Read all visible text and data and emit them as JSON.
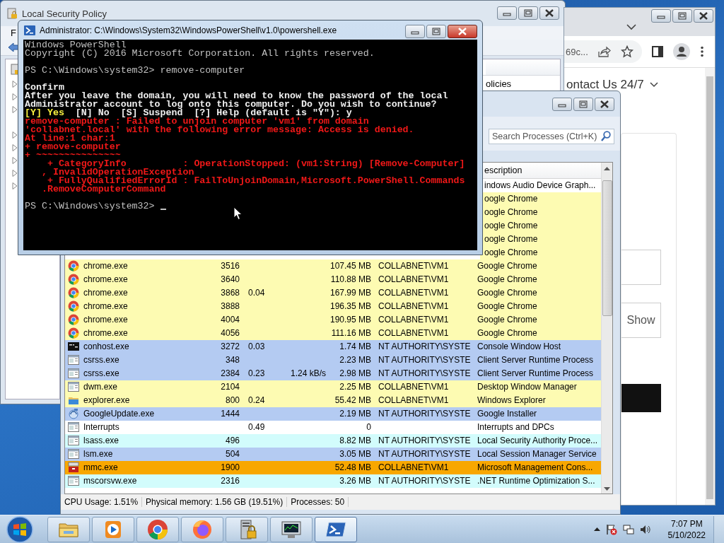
{
  "local_security_policy": {
    "title": "Local Security Policy",
    "menu": [
      "F"
    ],
    "tree_items": [
      {
        "kind": "node",
        "expanded": false
      },
      {
        "kind": "node",
        "expanded": false
      },
      {
        "kind": "node",
        "expanded": false
      },
      {
        "kind": "leaf"
      },
      {
        "kind": "node",
        "expanded": false
      },
      {
        "kind": "node",
        "expanded": false
      },
      {
        "kind": "node",
        "expanded": false
      },
      {
        "kind": "node",
        "expanded": false
      },
      {
        "kind": "node",
        "expanded": false
      }
    ],
    "list_items": [
      "olicies"
    ]
  },
  "browser": {
    "address": "69c...",
    "heading": "ontact Us 24/7",
    "show_button": "Show"
  },
  "process_explorer": {
    "search": {
      "placeholder": "Search Processes (Ctrl+K)"
    },
    "columns": [
      {
        "label": "escription"
      }
    ],
    "rows": [
      {
        "color": "#ffffff",
        "column_7": "indows Audio Device Graph..."
      },
      {
        "color": "#fdfbb2",
        "column_7": "oogle Chrome"
      },
      {
        "color": "#fdfbb2",
        "column_7": "oogle Chrome"
      },
      {
        "color": "#fdfbb2",
        "column_7": "oogle Chrome"
      },
      {
        "color": "#fdfbb2",
        "column_7": "oogle Chrome"
      },
      {
        "color": "#fdfbb2",
        "column_7": "oogle Chrome"
      },
      {
        "kind": "chrome",
        "color": "#fdfbb2",
        "column_1": "chrome.exe",
        "column_2": "3516",
        "column_5": "107.45 MB",
        "column_6": "COLLABNET\\VM1",
        "column_7": "Google Chrome"
      },
      {
        "kind": "chrome",
        "color": "#fdfbb2",
        "column_1": "chrome.exe",
        "column_2": "3640",
        "column_5": "110.88 MB",
        "column_6": "COLLABNET\\VM1",
        "column_7": "Google Chrome"
      },
      {
        "kind": "chrome",
        "color": "#fdfbb2",
        "column_1": "chrome.exe",
        "column_2": "3868",
        "column_3": "0.04",
        "column_5": "167.99 MB",
        "column_6": "COLLABNET\\VM1",
        "column_7": "Google Chrome"
      },
      {
        "kind": "chrome",
        "color": "#fdfbb2",
        "column_1": "chrome.exe",
        "column_2": "3888",
        "column_5": "196.35 MB",
        "column_6": "COLLABNET\\VM1",
        "column_7": "Google Chrome"
      },
      {
        "kind": "chrome",
        "color": "#fdfbb2",
        "column_1": "chrome.exe",
        "column_2": "4004",
        "column_5": "190.95 MB",
        "column_6": "COLLABNET\\VM1",
        "column_7": "Google Chrome"
      },
      {
        "kind": "chrome",
        "color": "#fdfbb2",
        "column_1": "chrome.exe",
        "column_2": "4056",
        "column_5": "111.16 MB",
        "column_6": "COLLABNET\\VM1",
        "column_7": "Google Chrome"
      },
      {
        "kind": "console",
        "color": "#b4cbf2",
        "column_1": "conhost.exe",
        "column_2": "3272",
        "column_3": "0.03",
        "column_5": "1.74 MB",
        "column_6": "NT AUTHORITY\\SYSTE",
        "column_7": "Console Window Host"
      },
      {
        "kind": "window",
        "color": "#b4cbf2",
        "column_1": "csrss.exe",
        "column_2": "348",
        "column_5": "2.23 MB",
        "column_6": "NT AUTHORITY\\SYSTE",
        "column_7": "Client Server Runtime Process"
      },
      {
        "kind": "window",
        "color": "#b4cbf2",
        "column_1": "csrss.exe",
        "column_2": "2384",
        "column_3": "0.23",
        "column_4": "1.24 kB/s",
        "column_5": "2.98 MB",
        "column_6": "NT AUTHORITY\\SYSTE",
        "column_7": "Client Server Runtime Process"
      },
      {
        "kind": "window",
        "color": "#fdfbb2",
        "column_1": "dwm.exe",
        "column_2": "2104",
        "column_5": "2.25 MB",
        "column_6": "COLLABNET\\VM1",
        "column_7": "Desktop Window Manager"
      },
      {
        "kind": "folder",
        "color": "#fdfbb2",
        "column_1": "explorer.exe",
        "column_2": "800",
        "column_3": "0.24",
        "column_5": "55.42 MB",
        "column_6": "COLLABNET\\VM1",
        "column_7": "Windows Explorer"
      },
      {
        "kind": "updater",
        "color": "#b4cbf2",
        "column_1": "GoogleUpdate.exe",
        "column_2": "1444",
        "column_5": "2.19 MB",
        "column_6": "NT AUTHORITY\\SYSTE",
        "column_7": "Google Installer"
      },
      {
        "kind": "window",
        "color": "#ffffff",
        "column_1": "Interrupts",
        "column_3": "0.49",
        "column_5": "0",
        "column_7": "Interrupts and DPCs"
      },
      {
        "kind": "window",
        "color": "#d2fcfc",
        "column_1": "lsass.exe",
        "column_2": "496",
        "column_5": "8.82 MB",
        "column_6": "NT AUTHORITY\\SYSTE",
        "column_7": "Local Security Authority Proce..."
      },
      {
        "kind": "window",
        "color": "#b4cbf2",
        "column_1": "lsm.exe",
        "column_2": "504",
        "column_5": "3.05 MB",
        "column_6": "NT AUTHORITY\\SYSTE",
        "column_7": "Local Session Manager Service"
      },
      {
        "kind": "toolbox",
        "color": "#f8a700",
        "column_1": "mmc.exe",
        "column_2": "1900",
        "column_5": "52.48 MB",
        "column_6": "COLLABNET\\VM1",
        "column_7": "Microsoft Management Cons..."
      },
      {
        "kind": "window",
        "color": "#d2fcfc",
        "column_1": "mscorsvw.exe",
        "column_2": "2316",
        "column_5": "3.26 MB",
        "column_6": "NT AUTHORITY\\SYSTE",
        "column_7": ".NET Runtime Optimization S..."
      }
    ],
    "status_bar": [
      "CPU Usage: 1.51%",
      "Physical memory: 1.56 GB (19.51%)",
      "Processes: 50"
    ]
  },
  "powershell": {
    "title": "Administrator: C:\\Windows\\System32\\WindowsPowerShell\\v1.0\\powershell.exe",
    "lines": [
      {
        "kind": "output",
        "text": "Windows PowerShell"
      },
      {
        "kind": "output",
        "text": "Copyright (C) 2016 Microsoft Corporation. All rights reserved."
      },
      {
        "kind": "blank"
      },
      {
        "kind": "output",
        "text": "PS C:\\Windows\\system32> remove-computer"
      },
      {
        "kind": "blank"
      },
      {
        "kind": "header",
        "text": "Confirm"
      },
      {
        "kind": "header",
        "text": "After you leave the domain, you will need to know the password of the local"
      },
      {
        "kind": "header",
        "text": "Administrator account to log onto this computer. Do you wish to continue?"
      },
      {
        "kind": "choice",
        "segments": [
          {
            "kind": "highlight",
            "text": "[Y] Yes"
          },
          {
            "kind": "header",
            "text": "  [N] No  [S] Suspend  [?] Help (default is \"Y\"): y"
          }
        ]
      },
      {
        "kind": "error",
        "text": "remove-computer : Failed to unjoin computer 'vm1' from domain"
      },
      {
        "kind": "error",
        "text": "'collabnet.local' with the following error message: Access is denied."
      },
      {
        "kind": "error",
        "text": "At line:1 char:1"
      },
      {
        "kind": "error",
        "text": "+ remove-computer"
      },
      {
        "kind": "error",
        "text": "+ ~~~~~~~~~~~~~~~"
      },
      {
        "kind": "error",
        "text": "    + CategoryInfo          : OperationStopped: (vm1:String) [Remove-Computer]"
      },
      {
        "kind": "error",
        "text": "   , InvalidOperationException"
      },
      {
        "kind": "error",
        "text": "    + FullyQualifiedErrorId : FailToUnjoinDomain,Microsoft.PowerShell.Commands"
      },
      {
        "kind": "error",
        "text": "   .RemoveComputerCommand"
      },
      {
        "kind": "blank"
      },
      {
        "kind": "output",
        "text": "PS C:\\Windows\\system32> ",
        "cursor": true
      }
    ]
  },
  "taskbar": {
    "items": [
      {
        "kind": "folder",
        "selected": false
      },
      {
        "kind": "media",
        "selected": false
      },
      {
        "kind": "chrome",
        "selected": false
      },
      {
        "kind": "firefox",
        "selected": false
      },
      {
        "kind": "server",
        "selected": false
      },
      {
        "kind": "monitor",
        "selected": false
      },
      {
        "kind": "powershell",
        "selected": true
      }
    ],
    "clock": {
      "time": "7:07 PM",
      "date": "5/10/2022"
    }
  }
}
